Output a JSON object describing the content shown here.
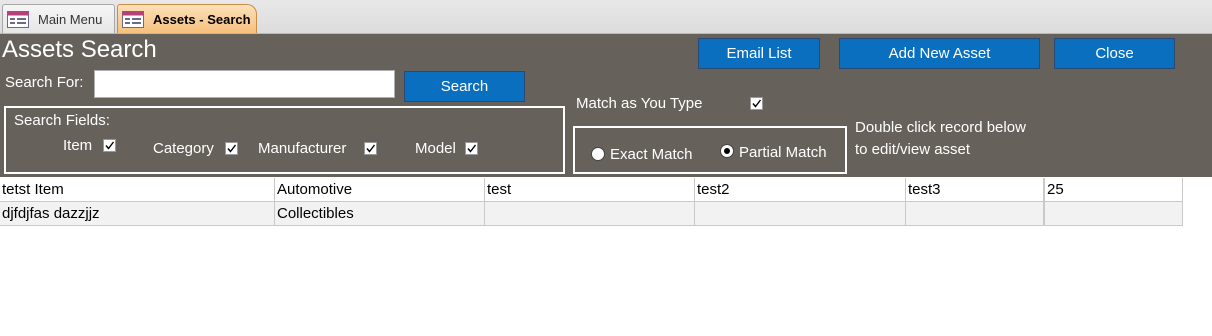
{
  "tabs": [
    {
      "label": "Main Menu",
      "icon": "form-icon"
    },
    {
      "label": "Assets - Search",
      "icon": "form-icon",
      "active": true
    }
  ],
  "form": {
    "title": "Assets Search",
    "buttons": {
      "email": "Email List",
      "add": "Add New Asset",
      "close": "Close",
      "search": "Search"
    },
    "search_label": "Search For:",
    "search_value": "",
    "fields_label": "Search Fields:",
    "fields": [
      {
        "label": "Item",
        "checked": true
      },
      {
        "label": "Category",
        "checked": true
      },
      {
        "label": "Manufacturer",
        "checked": true
      },
      {
        "label": "Model",
        "checked": true
      }
    ],
    "match_as_you_type": {
      "label": "Match as You Type",
      "checked": true
    },
    "match_options": [
      {
        "label": "Exact Match",
        "selected": false
      },
      {
        "label": "Partial Match",
        "selected": true
      }
    ],
    "hint_lines": [
      "Double click record below",
      "to edit/view asset"
    ]
  },
  "rows": [
    [
      "tetst Item",
      "Automotive",
      "test",
      "test2",
      "test3",
      "25"
    ],
    [
      "djfdjfas dazzjjz",
      "Collectibles",
      "",
      "",
      "",
      ""
    ]
  ],
  "colors": {
    "form_background": "#66615b",
    "button_blue": "#0b6fc0",
    "active_tab": "#f6c07d"
  }
}
